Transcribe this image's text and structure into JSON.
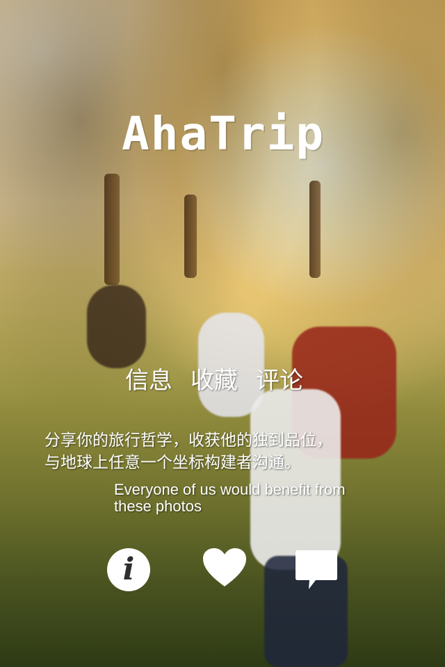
{
  "app": {
    "logo_text": "AhaTrip"
  },
  "tabs": [
    {
      "label": "信息"
    },
    {
      "label": "收藏"
    },
    {
      "label": "评论"
    }
  ],
  "tagline": {
    "line1": "分享你的旅行哲学，收获他的独到品位，",
    "line2": "与地球上任意一个坐标构建者沟通。"
  },
  "english": {
    "line1": "Everyone of us would benefit from",
    "line2": "these photos"
  },
  "icons": {
    "info": "info-icon",
    "favorite": "heart-icon",
    "comment": "speech-bubble-icon",
    "info_glyph": "i"
  },
  "colors": {
    "text": "#ffffff",
    "info_glyph": "#2e2e2e"
  }
}
